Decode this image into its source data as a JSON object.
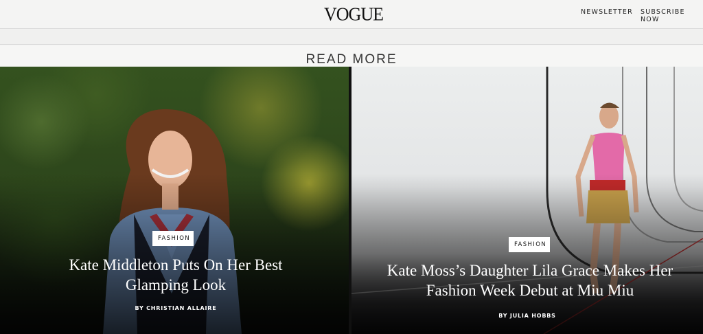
{
  "header": {
    "logo": "VOGUE",
    "nav": {
      "newsletter": "NEWSLETTER",
      "subscribe": "SUBSCRIBE NOW"
    }
  },
  "section": {
    "title": "READ MORE"
  },
  "cards": [
    {
      "tag": "FASHION",
      "headline": "Kate Middleton Puts On Her Best Glamping Look",
      "byline": "BY CHRISTIAN ALLAIRE"
    },
    {
      "tag": "FASHION",
      "headline": "Kate Moss’s Daughter Lila Grace Makes Her Fashion Week Debut at Miu Miu",
      "byline": "BY JULIA HOBBS"
    }
  ],
  "colors": {
    "background": "#f2f2f0",
    "text_dark": "#111111",
    "overlay_text": "#ffffff"
  }
}
